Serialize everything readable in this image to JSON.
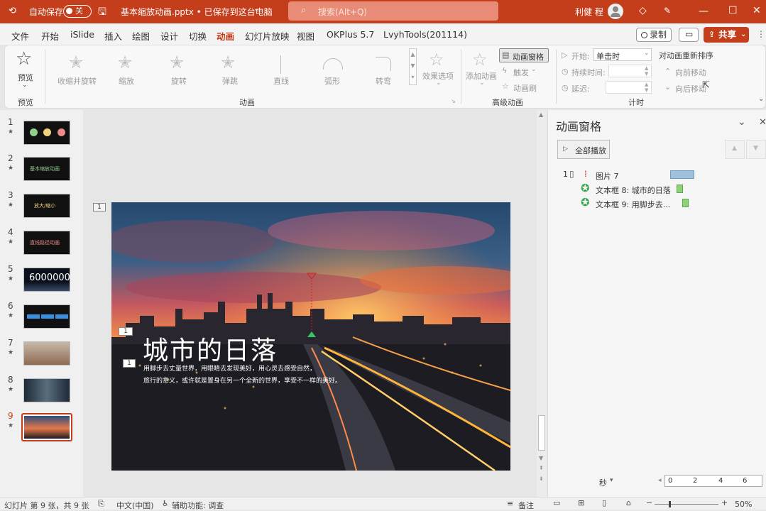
{
  "titlebar": {
    "autosave_label": "自动保存",
    "autosave_state": "关",
    "doc_title": "基本缩放动画.pptx • 已保存到这台电脑",
    "search_placeholder": "搜索(Alt+Q)",
    "user_name": "利健 程"
  },
  "menu": {
    "tabs": [
      "文件",
      "开始",
      "iSlide",
      "插入",
      "绘图",
      "设计",
      "切换",
      "动画",
      "幻灯片放映",
      "视图",
      "OKPlus 5.7",
      "LvyhTools(201114)"
    ],
    "active": "动画",
    "record_label": "录制",
    "share_label": "共享"
  },
  "ribbon": {
    "preview_label": "预览",
    "preview_group": "预览",
    "effects": [
      "收缩并旋转",
      "缩放",
      "旋转",
      "弹跳",
      "直线",
      "弧形",
      "转弯"
    ],
    "effect_options": "效果选项",
    "animation_group": "动画",
    "add_animation": "添加动画",
    "animation_pane_btn": "动画窗格",
    "trigger": "触发",
    "painter": "动画刷",
    "advanced_group": "高级动画",
    "start_label": "开始:",
    "start_value": "单击时",
    "duration_label": "持续时间:",
    "delay_label": "延迟:",
    "timing_group": "计时",
    "reorder_label": "对动画重新排序",
    "move_earlier": "向前移动",
    "move_later": "向后移动"
  },
  "slides": {
    "items": [
      {
        "num": "1",
        "text": ""
      },
      {
        "num": "2",
        "text": "基本缩放动画"
      },
      {
        "num": "3",
        "text": "放大/缩小"
      },
      {
        "num": "4",
        "text": "直线路径动画"
      },
      {
        "num": "5",
        "text": "6000000"
      },
      {
        "num": "6",
        "text": ""
      },
      {
        "num": "7",
        "text": ""
      },
      {
        "num": "8",
        "text": ""
      },
      {
        "num": "9",
        "text": ""
      }
    ],
    "selected": "9",
    "star": "★"
  },
  "slide": {
    "title": "城市的日落",
    "line1": "用脚步去丈量世界，用眼睛去发现美好，用心灵去感受自然，",
    "line2": "旅行的意义，或许就是置身在另一个全新的世界，享受不一样的美好。",
    "tag_top": "1",
    "tag_title": "1",
    "tag_text": "1",
    "outside_tag": "1"
  },
  "anipane": {
    "title": "动画窗格",
    "play_all": "全部播放",
    "items": [
      {
        "num": "1",
        "name": "图片 7"
      },
      {
        "num": "",
        "name": "文本框 8: 城市的日落"
      },
      {
        "num": "",
        "name": "文本框 9: 用脚步去..."
      }
    ],
    "seconds_label": "秒",
    "timeline_ticks": [
      "0",
      "2",
      "4",
      "6"
    ]
  },
  "statusbar": {
    "slide_info": "幻灯片 第 9 张，共 9 张",
    "language": "中文(中国)",
    "accessibility": "辅助功能: 调查",
    "notes": "备注",
    "zoom": "50%"
  },
  "colors": {
    "accent": "#c43e1c",
    "anim_bar_blue": "#9fc2dc",
    "anim_bar_green": "#8ed17a",
    "emphasis_star": "#3aa64a"
  }
}
